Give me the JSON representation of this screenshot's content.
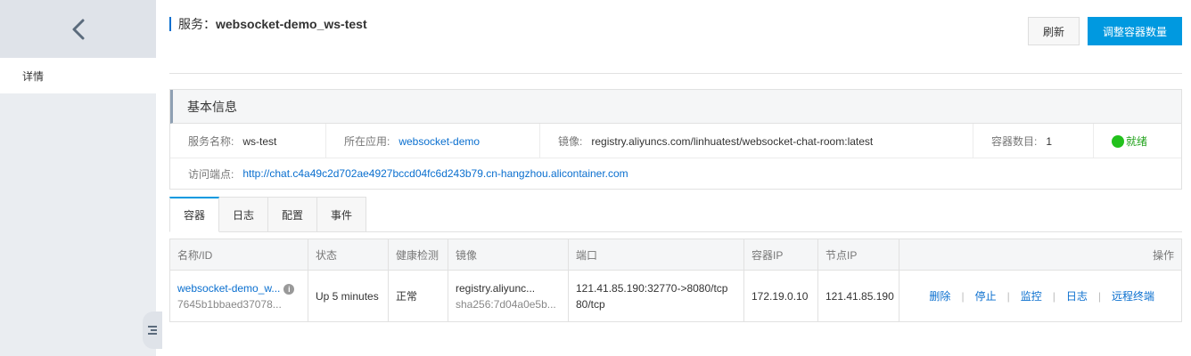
{
  "sidebar": {
    "items": [
      {
        "label": "详情"
      }
    ]
  },
  "header": {
    "title_prefix": "服务：",
    "title_name": "websocket-demo_ws-test",
    "refresh_label": "刷新",
    "scale_label": "调整容器数量"
  },
  "info": {
    "heading": "基本信息",
    "service_name_label": "服务名称:",
    "service_name": "ws-test",
    "app_label": "所在应用:",
    "app": "websocket-demo",
    "image_label": "镜像:",
    "image": "registry.aliyuncs.com/linhuatest/websocket-chat-room:latest",
    "count_label": "容器数目:",
    "count": "1",
    "status": "就绪",
    "endpoint_label": "访问端点:",
    "endpoint": "http://chat.c4a49c2d702ae4927bccd04fc6d243b79.cn-hangzhou.alicontainer.com"
  },
  "tabs": [
    {
      "label": "容器"
    },
    {
      "label": "日志"
    },
    {
      "label": "配置"
    },
    {
      "label": "事件"
    }
  ],
  "table": {
    "headers": [
      "名称/ID",
      "状态",
      "健康检测",
      "镜像",
      "端口",
      "容器IP",
      "节点IP",
      "操作"
    ],
    "rows": [
      {
        "name": "websocket-demo_w...",
        "id": "7645b1bbaed37078...",
        "status": "Up 5 minutes",
        "health": "正常",
        "image": "registry.aliyunc...",
        "image_sha": "sha256:7d04a0e5b...",
        "port_line1": "121.41.85.190:32770->8080/tcp",
        "port_line2": "80/tcp",
        "container_ip": "172.19.0.10",
        "node_ip": "121.41.85.190",
        "actions": [
          "删除",
          "停止",
          "监控",
          "日志",
          "远程终端"
        ]
      }
    ]
  },
  "colors": {
    "accent": "#0099e0",
    "link": "#0a6fcf",
    "status_green": "#22c11c"
  },
  "icons": [
    "chevron-left-icon",
    "info-icon",
    "menu-toggle-icon"
  ]
}
